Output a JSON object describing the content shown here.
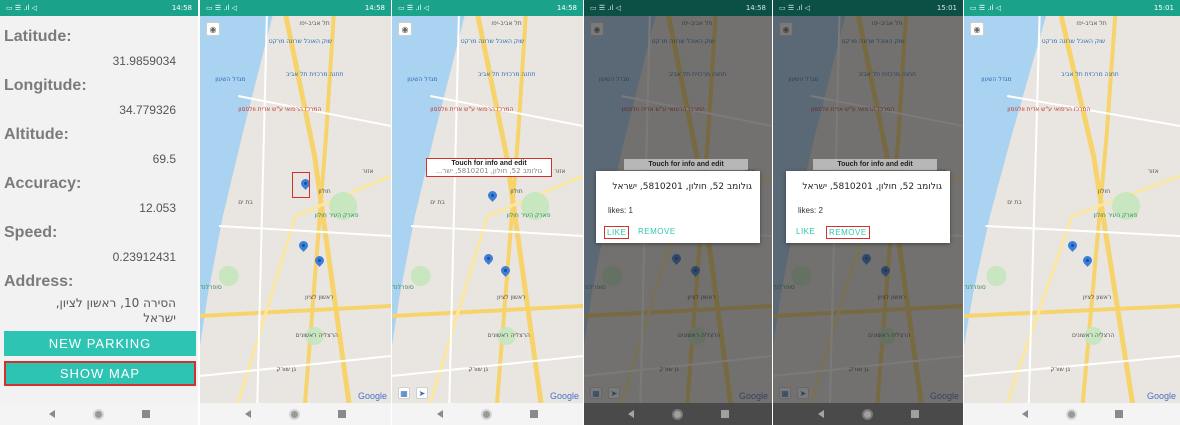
{
  "status": {
    "left_icons": "▭ ☰ .ıl ◁",
    "time_a": "14:58",
    "time_b": "15:01",
    "right_icons": "⚙ ✚ ◔ ⏰"
  },
  "info_screen": {
    "latitude_label": "Latitude:",
    "latitude_value": "31.9859034",
    "longitude_label": "Longitude:",
    "longitude_value": "34.779326",
    "altitude_label": "Altitude:",
    "altitude_value": "69.5",
    "accuracy_label": "Accuracy:",
    "accuracy_value": "12.053",
    "speed_label": "Speed:",
    "speed_value": "0.23912431",
    "address_label": "Address:",
    "address_value": "הסירה 10, ראשון לציון, ישראל",
    "new_parking_button": "NEW PARKING",
    "show_map_button": "SHOW MAP"
  },
  "map": {
    "google_logo": "Google",
    "place_labels": {
      "tel_aviv": "תל אביב-יפו",
      "azor": "אזור",
      "holon": "חולון",
      "bat_yam": "בת ים",
      "rishon": "ראשון לציון",
      "hospital": "המרכז הרפואי ע\"ש אדית וולפסון",
      "sea_tower": "מגדל השעון",
      "station": "תחנה מרכזית תל אביב",
      "market": "שוק האוכל שרונה מרקט",
      "holon_park": "פארק העיר חולון",
      "supercom": "סופרלנד",
      "hashiv": "הרצליה ראשונים",
      "gan_sorek": "גן שורק",
      "beit_hanan": "בית חנן",
      "nes_ziona": "נס ציונה",
      "bitzaron": "ביצרון",
      "gan_haim": "גן ח"
    },
    "tooltip_title": "Touch for info and edit",
    "tooltip_address": "גולומב 52, חולון, 5810201, ישר...",
    "dialog_address": "גולומב 52, חולון, 5810201, ישראל",
    "likes_one": "likes: 1",
    "likes_two": "likes: 2",
    "like_button": "LIKE",
    "remove_button": "REMOVE",
    "my_location_icon": "◉",
    "nav_icon": "➤",
    "maps_icon": "▦"
  },
  "navbar": {
    "back": "◀",
    "home": "●",
    "recent": "■"
  }
}
